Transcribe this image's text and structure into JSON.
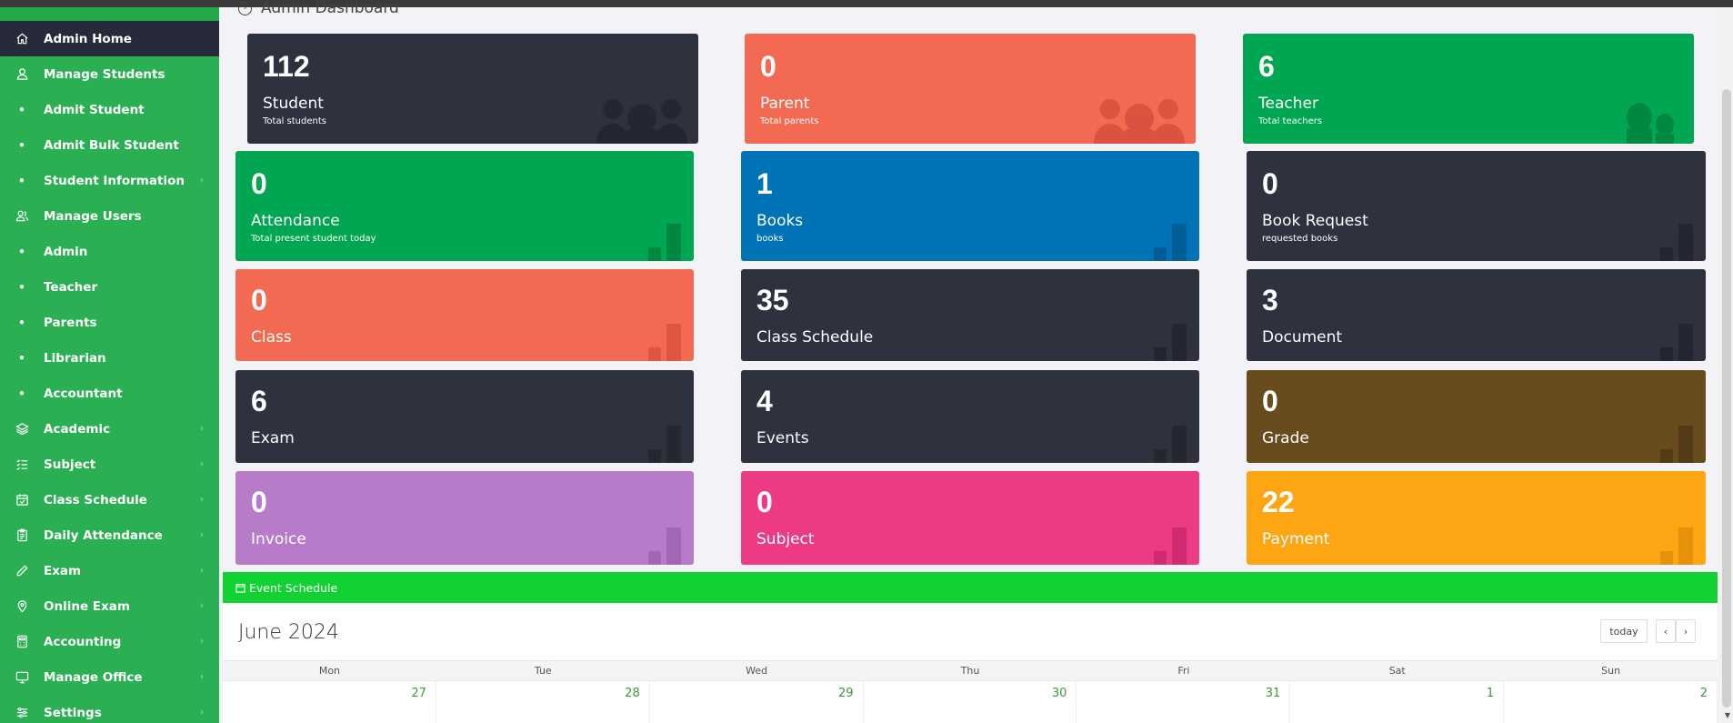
{
  "page": {
    "title": "Admin Dashboard"
  },
  "sidebar": {
    "items": [
      {
        "label": "Admin Home",
        "icon": "home-icon",
        "type": "main",
        "active": true
      },
      {
        "label": "Manage Students",
        "icon": "user-icon",
        "type": "main"
      },
      {
        "label": "Admit Student",
        "type": "sub"
      },
      {
        "label": "Admit Bulk Student",
        "type": "sub"
      },
      {
        "label": "Student Information",
        "type": "sub",
        "chevron": true
      },
      {
        "label": "Manage Users",
        "icon": "users-icon",
        "type": "main"
      },
      {
        "label": "Admin",
        "type": "sub"
      },
      {
        "label": "Teacher",
        "type": "sub"
      },
      {
        "label": "Parents",
        "type": "sub"
      },
      {
        "label": "Librarian",
        "type": "sub"
      },
      {
        "label": "Accountant",
        "type": "sub"
      },
      {
        "label": "Academic",
        "icon": "layers-icon",
        "type": "main",
        "chevron": true
      },
      {
        "label": "Subject",
        "icon": "list-icon",
        "type": "main",
        "chevron": true
      },
      {
        "label": "Class Schedule",
        "icon": "calendar-check-icon",
        "type": "main",
        "chevron": true
      },
      {
        "label": "Daily Attendance",
        "icon": "clipboard-icon",
        "type": "main",
        "chevron": true
      },
      {
        "label": "Exam",
        "icon": "pencil-icon",
        "type": "main",
        "chevron": true
      },
      {
        "label": "Online Exam",
        "icon": "map-pin-icon",
        "type": "main",
        "chevron": true
      },
      {
        "label": "Accounting",
        "icon": "calculator-icon",
        "type": "main",
        "chevron": true
      },
      {
        "label": "Manage Office",
        "icon": "monitor-icon",
        "type": "main",
        "chevron": true
      },
      {
        "label": "Settings",
        "icon": "sliders-icon",
        "type": "main",
        "chevron": true
      }
    ]
  },
  "cards": [
    {
      "value": "112",
      "label": "Student",
      "sub": "Total students",
      "color": "#2e323e",
      "deco": "people"
    },
    {
      "value": "0",
      "label": "Parent",
      "sub": "Total parents",
      "color": "#f36a52",
      "deco": "people"
    },
    {
      "value": "6",
      "label": "Teacher",
      "sub": "Total teachers",
      "color": "#00a651",
      "deco": "people2"
    },
    {
      "value": "0",
      "label": "Attendance",
      "sub": "Total present student today",
      "color": "#00a651",
      "deco": "bars"
    },
    {
      "value": "1",
      "label": "Books",
      "sub": "books",
      "color": "#0073b7",
      "deco": "bars"
    },
    {
      "value": "0",
      "label": "Book Request",
      "sub": "requested books",
      "color": "#2e323e",
      "deco": "bars"
    },
    {
      "value": "0",
      "label": "Class",
      "sub": "",
      "color": "#f36a52",
      "deco": "bars"
    },
    {
      "value": "35",
      "label": "Class Schedule",
      "sub": "",
      "color": "#2e323e",
      "deco": "bars"
    },
    {
      "value": "3",
      "label": "Document",
      "sub": "",
      "color": "#2e323e",
      "deco": "bars"
    },
    {
      "value": "6",
      "label": "Exam",
      "sub": "",
      "color": "#2e323e",
      "deco": "bars"
    },
    {
      "value": "4",
      "label": "Events",
      "sub": "",
      "color": "#2e323e",
      "deco": "bars"
    },
    {
      "value": "0",
      "label": "Grade",
      "sub": "",
      "color": "#694c1d",
      "deco": "bars"
    },
    {
      "value": "0",
      "label": "Invoice",
      "sub": "",
      "color": "#b87bca",
      "deco": "bars"
    },
    {
      "value": "0",
      "label": "Subject",
      "sub": "",
      "color": "#ec3a84",
      "deco": "bars"
    },
    {
      "value": "22",
      "label": "Payment",
      "sub": "",
      "color": "#fda512",
      "deco": "bars"
    }
  ],
  "calendar": {
    "panel_title": "Event Schedule",
    "month_title": "June 2024",
    "today_label": "today",
    "prev_label": "‹",
    "next_label": "›",
    "weekdays": [
      "Mon",
      "Tue",
      "Wed",
      "Thu",
      "Fri",
      "Sat",
      "Sun"
    ],
    "first_row_dates": [
      "27",
      "28",
      "29",
      "30",
      "31",
      "1",
      "2"
    ]
  }
}
